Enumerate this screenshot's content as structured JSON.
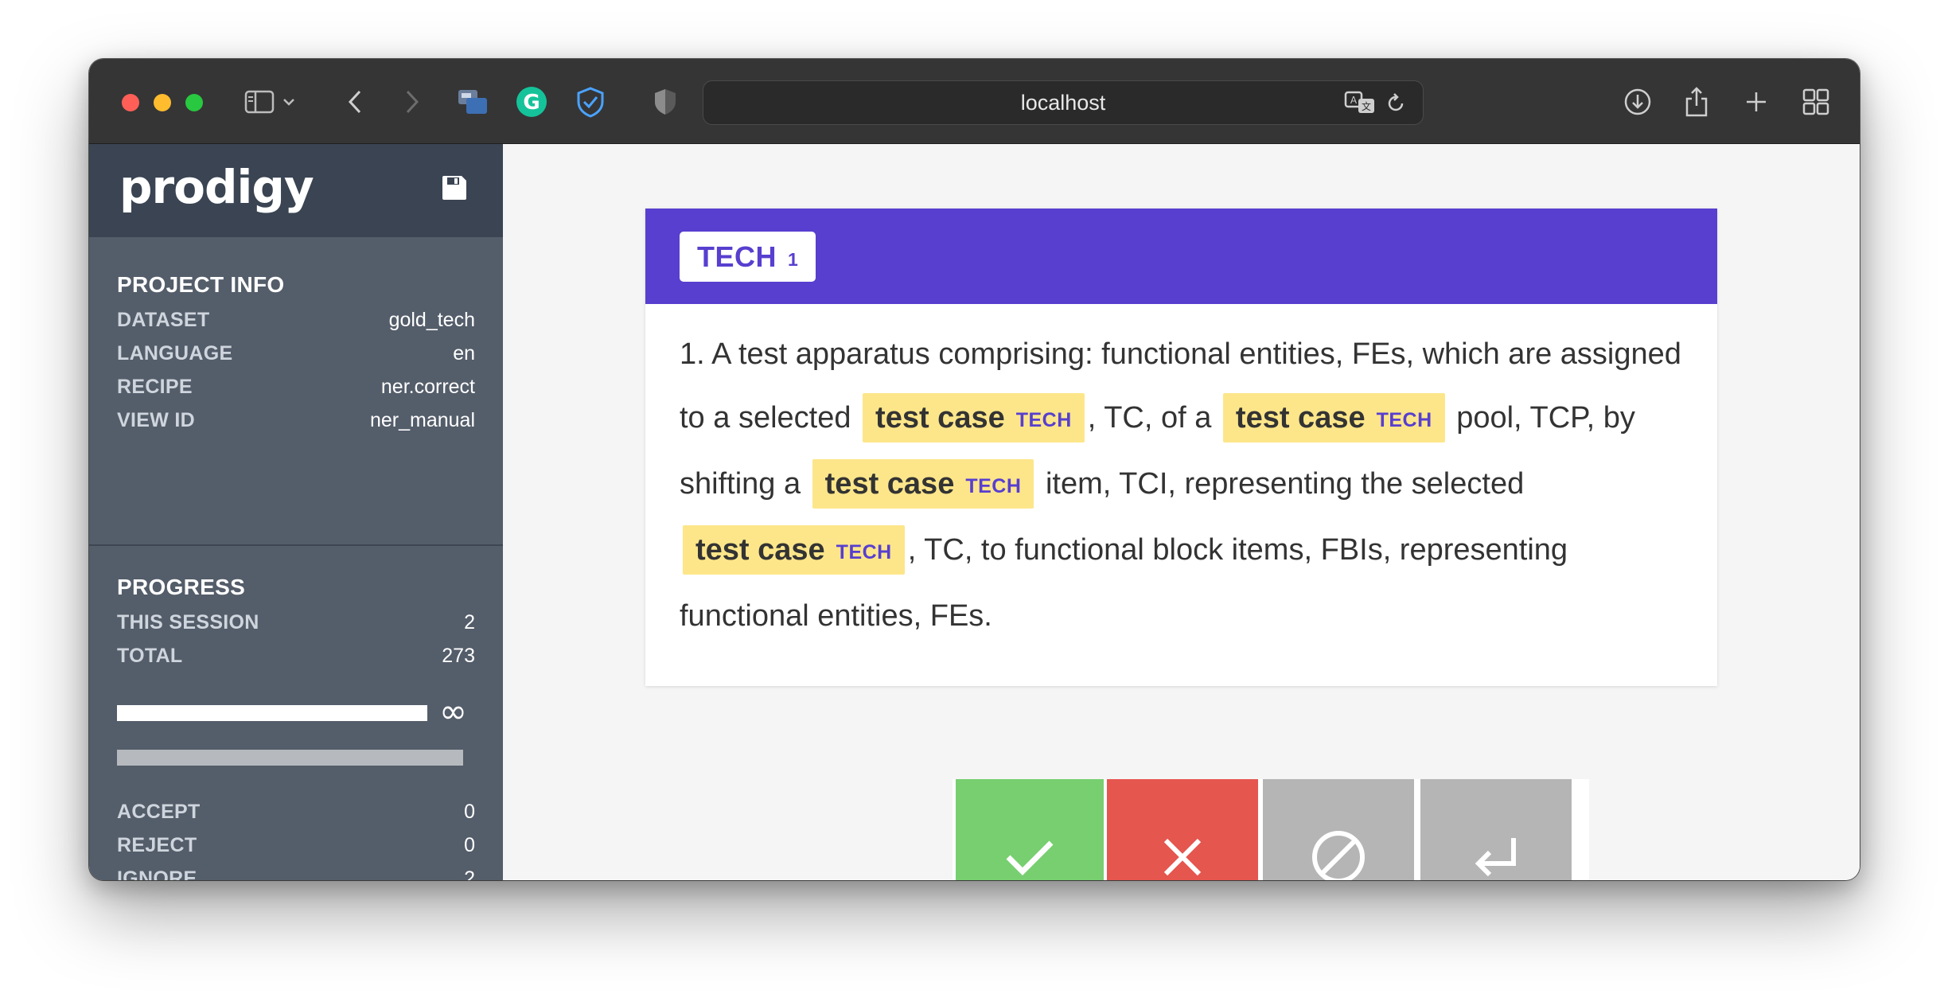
{
  "browser": {
    "url": "localhost"
  },
  "app": {
    "logo": "prodigy"
  },
  "project_info": {
    "title": "PROJECT INFO",
    "rows": [
      {
        "key": "DATASET",
        "value": "gold_tech"
      },
      {
        "key": "LANGUAGE",
        "value": "en"
      },
      {
        "key": "RECIPE",
        "value": "ner.correct"
      },
      {
        "key": "VIEW ID",
        "value": "ner_manual"
      }
    ]
  },
  "progress": {
    "title": "PROGRESS",
    "rows": [
      {
        "key": "THIS SESSION",
        "value": "2"
      },
      {
        "key": "TOTAL",
        "value": "273"
      }
    ],
    "infinity": "∞",
    "session_fraction": 1.0,
    "counts": [
      {
        "key": "ACCEPT",
        "value": "0"
      },
      {
        "key": "REJECT",
        "value": "0"
      },
      {
        "key": "IGNORE",
        "value": "2"
      }
    ]
  },
  "labels": [
    {
      "name": "TECH",
      "number": "1"
    }
  ],
  "task": {
    "segments": [
      {
        "t": "1. A test apparatus comprising: functional entities, FEs, which are assigned to a selected "
      },
      {
        "ent": "test case",
        "label": "TECH"
      },
      {
        "t": ", TC, of a "
      },
      {
        "ent": "test case",
        "label": "TECH"
      },
      {
        "t": " pool, TCP, by shifting a "
      },
      {
        "ent": "test case",
        "label": "TECH"
      },
      {
        "t": " item, TCI, representing the selected "
      },
      {
        "ent": "test case",
        "label": "TECH"
      },
      {
        "t": ", TC, to functional block items, FBIs, representing functional entities, FEs."
      }
    ]
  },
  "colors": {
    "accept": "#77cf6f",
    "reject": "#e5564f",
    "ignore": "#b5b5b5",
    "undo": "#b5b5b5",
    "label": "#583fcf",
    "entity_bg": "#fde68a",
    "sidebar": "#545d6a"
  },
  "icons": {
    "accept": "check-icon",
    "reject": "cross-icon",
    "ignore": "ignore-icon",
    "undo": "undo-icon"
  }
}
